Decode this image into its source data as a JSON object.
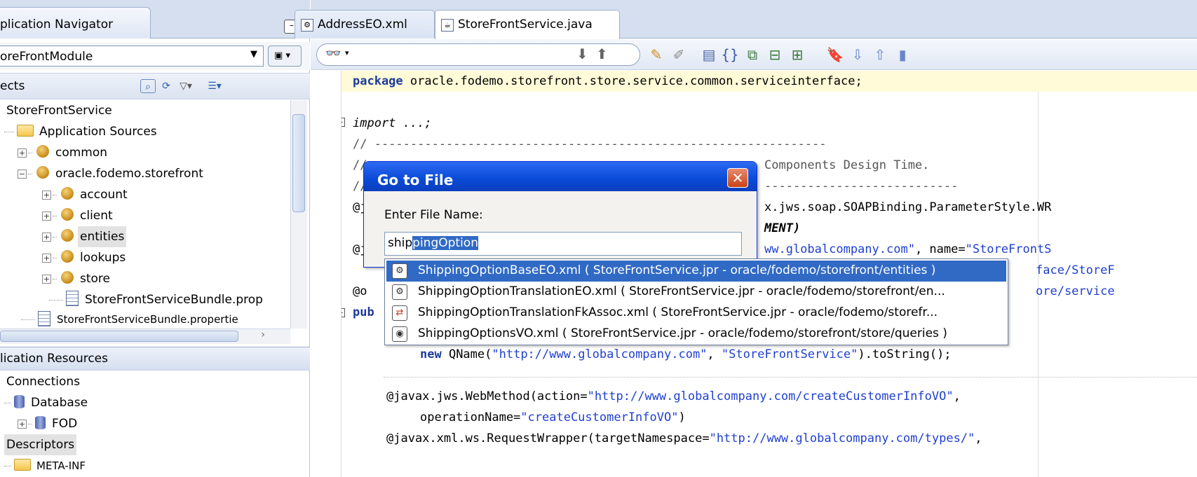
{
  "navigator": {
    "tab_title": "plication Navigator",
    "project_combo": "oreFrontModule",
    "projects_label": "ects",
    "tree": [
      {
        "label": "StoreFrontService",
        "type": "project"
      },
      {
        "label": "Application Sources",
        "type": "folder"
      },
      {
        "label": "common",
        "type": "package"
      },
      {
        "label": "oracle.fodemo.storefront",
        "type": "package"
      },
      {
        "label": "account",
        "type": "package"
      },
      {
        "label": "client",
        "type": "package"
      },
      {
        "label": "entities",
        "type": "package"
      },
      {
        "label": "lookups",
        "type": "package"
      },
      {
        "label": "store",
        "type": "package"
      },
      {
        "label": "StoreFrontServiceBundle.prop",
        "type": "file"
      },
      {
        "label": "StoreFrontServiceBundle.propertie",
        "type": "file"
      }
    ],
    "resources_title": "lication Resources",
    "resources": [
      {
        "label": "Connections"
      },
      {
        "label": "Database"
      },
      {
        "label": "FOD"
      },
      {
        "label": "Descriptors"
      },
      {
        "label": "META-INF"
      }
    ]
  },
  "editor": {
    "tabs": [
      {
        "label": "AddressEO.xml",
        "active": false
      },
      {
        "label": "StoreFrontService.java",
        "active": true
      }
    ],
    "code": {
      "package_kw": "package",
      "package_rest": " oracle.fodemo.storefront.store.service.common.serviceinterface;",
      "import_line": "import ...;",
      "comment_1": "// ---------------------------------------------------------------",
      "comment_2_tail": "Components Design Time.",
      "comment_3": "//",
      "frag_a1": "@j",
      "frag_a2": "x.jws.soap.SOAPBinding.ParameterStyle.WR",
      "frag_b": "MENT)",
      "frag_c1": "@j",
      "frag_c2_str": "ww.globalcompany.com\"",
      "frag_c2_rest": ", name=",
      "frag_c2_str2": "\"StoreFrontS",
      "frag_d": "face/StoreF",
      "frag_e1": "@o",
      "frag_e2": "ore/service",
      "frag_f": "pub",
      "qname_kw": "new",
      "qname_rest1": " QName(",
      "qname_str1": "\"http://www.globalcompany.com\"",
      "qname_rest2": ", ",
      "qname_str2": "\"StoreFrontService\"",
      "qname_rest3": ").toString();",
      "webmethod_1": "@javax.jws.WebMethod(action=",
      "webmethod_1_str": "\"http://www.globalcompany.com/createCustomerInfoVO\"",
      "webmethod_1_end": ",",
      "webmethod_2": "operationName=",
      "webmethod_2_str": "\"createCustomerInfoVO\"",
      "webmethod_2_end": ")",
      "wrapper": "@javax.xml.ws.RequestWrapper(targetNamespace=",
      "wrapper_str": "\"http://www.globalcompany.com/types/\""
    }
  },
  "dialog": {
    "title": "Go to File",
    "close_label": "✕",
    "input_label": "Enter File Name:",
    "input_typed": "ship",
    "input_selected": "pingOption",
    "suggestions": [
      {
        "text": "ShippingOptionBaseEO.xml ( StoreFrontService.jpr - oracle/fodemo/storefront/entities )",
        "selected": true
      },
      {
        "text": "ShippingOptionTranslationEO.xml ( StoreFrontService.jpr - oracle/fodemo/storefront/en...",
        "selected": false
      },
      {
        "text": "ShippingOptionTranslationFkAssoc.xml ( StoreFrontService.jpr - oracle/fodemo/storefr...",
        "selected": false
      },
      {
        "text": "ShippingOptionsVO.xml ( StoreFrontService.jpr - oracle/fodemo/storefront/store/queries )",
        "selected": false
      }
    ]
  },
  "colors": {
    "accent_blue": "#316ac5",
    "title_bar": "#0a4ad6",
    "keyword": "#1d3b9c",
    "string": "#2040d0"
  }
}
